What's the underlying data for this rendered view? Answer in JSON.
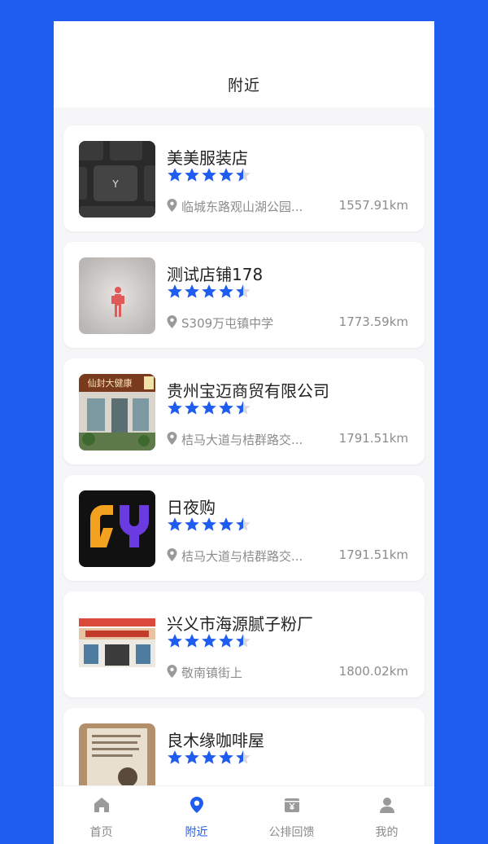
{
  "header": {
    "title": "附近"
  },
  "stores": [
    {
      "name": "美美服装店",
      "rating": 4.5,
      "address": "临城东路观山湖公园...",
      "distance": "1557.91km",
      "thumb": "keyboard-photo"
    },
    {
      "name": "测试店铺178",
      "rating": 4.5,
      "address": "S309万屯镇中学",
      "distance": "1773.59km",
      "thumb": "sign-photo"
    },
    {
      "name": "贵州宝迈商贸有限公司",
      "rating": 4.5,
      "address": "桔马大道与桔群路交...",
      "distance": "1791.51km",
      "thumb": "storefront-photo",
      "thumb_sign": "仙封大健康"
    },
    {
      "name": "日夜购",
      "rating": 4.5,
      "address": "桔马大道与桔群路交...",
      "distance": "1791.51km",
      "thumb": "ry-logo"
    },
    {
      "name": "兴义市海源腻子粉厂",
      "rating": 4.5,
      "address": "敬南镇街上",
      "distance": "1800.02km",
      "thumb": "factory-photo"
    },
    {
      "name": "良木缘咖啡屋",
      "rating": 4.5,
      "address": "",
      "distance": "",
      "thumb": "notice-photo"
    }
  ],
  "tabbar": [
    {
      "label": "首页",
      "icon": "home-icon",
      "active": false
    },
    {
      "label": "附近",
      "icon": "location-pin-icon",
      "active": true
    },
    {
      "label": "公排回馈",
      "icon": "yen-box-icon",
      "active": false
    },
    {
      "label": "我的",
      "icon": "person-icon",
      "active": false
    }
  ],
  "colors": {
    "accent": "#1f5cf0",
    "star": "#1f5cf0",
    "text": "#222222",
    "muted": "#8c8c8c"
  }
}
